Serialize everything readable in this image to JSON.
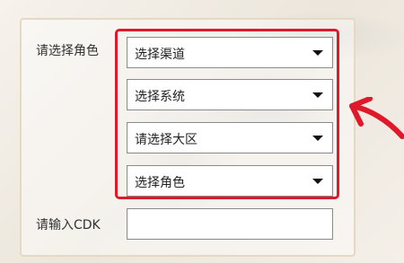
{
  "form": {
    "role_label": "请选择角色",
    "cdk_label": "请输入CDK",
    "selects": [
      {
        "selected": "选择渠道"
      },
      {
        "selected": "选择系统"
      },
      {
        "selected": "请选择大区"
      },
      {
        "selected": "选择角色"
      }
    ],
    "cdk_value": ""
  },
  "colors": {
    "highlight": "#e0192a",
    "panel_border": "#e6d9c3",
    "annotation_arrow": "#e0192a"
  },
  "icons": {
    "select_caret": "chevron-down-icon",
    "annotation": "curved-arrow-icon"
  }
}
